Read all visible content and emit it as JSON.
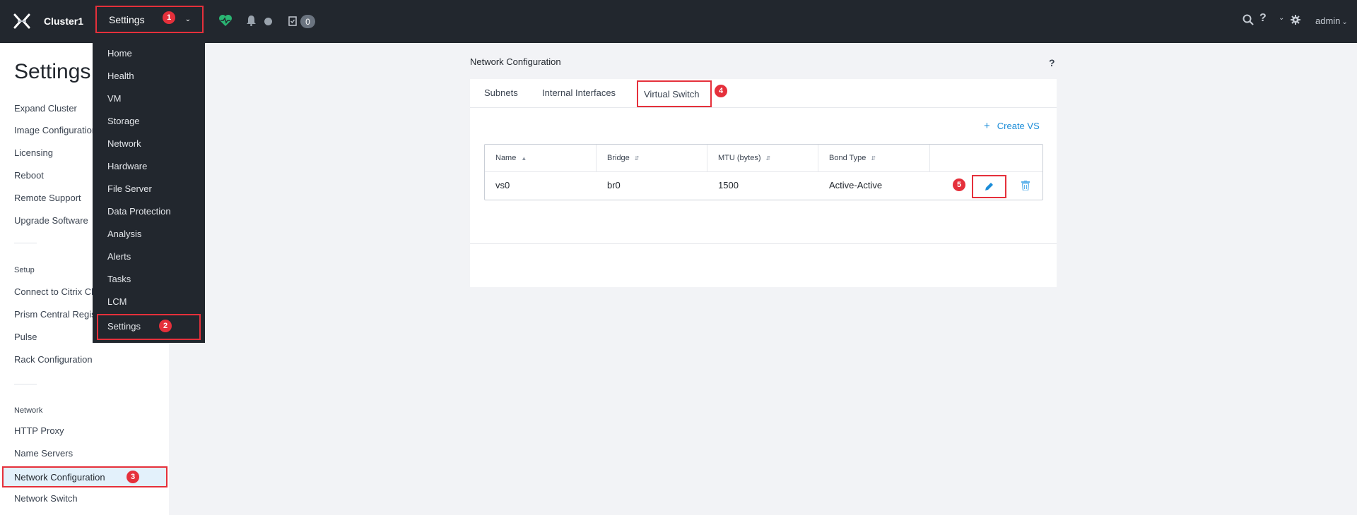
{
  "topbar": {
    "cluster_name": "Cluster1",
    "menu_label": "Settings",
    "tasks_count": "0",
    "user": "admin"
  },
  "badges": {
    "b1": "1",
    "b2": "2",
    "b3": "3",
    "b4": "4",
    "b5": "5"
  },
  "dropdown": {
    "items": [
      "Home",
      "Health",
      "VM",
      "Storage",
      "Network",
      "Hardware",
      "File Server",
      "Data Protection",
      "Analysis",
      "Alerts",
      "Tasks",
      "LCM"
    ],
    "selected": "Settings"
  },
  "sidebar": {
    "title": "Settings",
    "general_items": [
      "Expand Cluster",
      "Image Configuration",
      "Licensing",
      "Reboot",
      "Remote Support",
      "Upgrade Software"
    ],
    "setup_label": "Setup",
    "setup_items": [
      "Connect to Citrix Cloud",
      "Prism Central Registration",
      "Pulse",
      "Rack Configuration"
    ],
    "network_label": "Network",
    "network_items": [
      "HTTP Proxy",
      "Name Servers"
    ],
    "active_item": "Network Configuration",
    "after_active": "Network Switch"
  },
  "main": {
    "title": "Network Configuration",
    "help": "?",
    "tabs": [
      "Subnets",
      "Internal Interfaces"
    ],
    "active_tab": "Virtual Switch",
    "create_label": "Create VS",
    "table": {
      "headers": [
        "Name",
        "Bridge",
        "MTU (bytes)",
        "Bond Type"
      ],
      "rows": [
        {
          "name": "vs0",
          "bridge": "br0",
          "mtu": "1500",
          "bond": "Active-Active"
        }
      ]
    }
  },
  "colors": {
    "topbar": "#22272e",
    "highlight": "#e5303b",
    "link": "#1a8cd8",
    "health": "#2ab673"
  }
}
